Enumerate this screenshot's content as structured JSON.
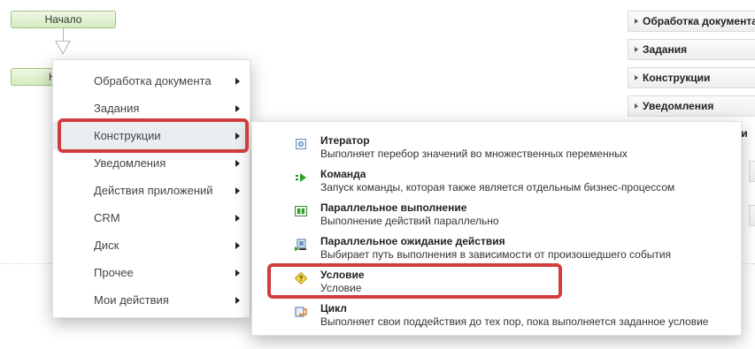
{
  "canvas": {
    "start_node_label": "Начало",
    "second_node_label": "Н"
  },
  "palette": {
    "groups": [
      {
        "label": "Обработка документа"
      },
      {
        "label": "Задания"
      },
      {
        "label": "Конструкции"
      },
      {
        "label": "Уведомления"
      }
    ],
    "partial_label": "ни"
  },
  "menu": {
    "items": [
      {
        "label": "Обработка документа"
      },
      {
        "label": "Задания"
      },
      {
        "label": "Конструкции"
      },
      {
        "label": "Уведомления"
      },
      {
        "label": "Действия приложений"
      },
      {
        "label": "CRM"
      },
      {
        "label": "Диск"
      },
      {
        "label": "Прочее"
      },
      {
        "label": "Мои действия"
      }
    ],
    "active_item": "Конструкции"
  },
  "submenu": {
    "items": [
      {
        "title": "Итератор",
        "description": "Выполняет перебор значений во множественных переменных",
        "icon": "iterator-icon"
      },
      {
        "title": "Команда",
        "description": "Запуск команды, которая также является отдельным бизнес-процессом",
        "icon": "command-icon"
      },
      {
        "title": "Параллельное выполнение",
        "description": "Выполнение действий параллельно",
        "icon": "parallel-icon"
      },
      {
        "title": "Параллельное ожидание действия",
        "description": "Выбирает путь выполнения в зависимости от произошедшего события",
        "icon": "parallel-wait-icon"
      },
      {
        "title": "Условие",
        "description": "Условие",
        "icon": "condition-icon"
      },
      {
        "title": "Цикл",
        "description": "Выполняет свои поддействия до тех пор, пока выполняется заданное условие",
        "icon": "loop-icon"
      }
    ]
  },
  "colors": {
    "highlight": "#d23c3c",
    "node_green": "#d5ebc0",
    "menu_active": "#eaeef0"
  }
}
